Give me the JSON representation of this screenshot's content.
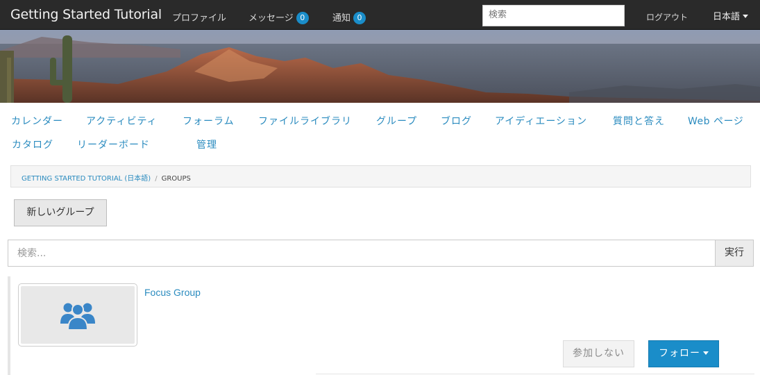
{
  "navbar": {
    "brand": "Getting Started Tutorial",
    "profile_label": "プロファイル",
    "messages_label": "メッセージ",
    "messages_count": "0",
    "notifications_label": "通知",
    "notifications_count": "0",
    "search_placeholder": "検索",
    "logout_label": "ログアウト",
    "language_label": "日本語"
  },
  "menu": {
    "items": [
      "カレンダー",
      "アクティビティ",
      "フォーラム",
      "ファイルライブラリ",
      "グループ",
      "ブログ",
      "アイディエーション",
      "質問と答え",
      "Web ページ",
      "カタログ",
      "リーダーボード",
      "管理"
    ]
  },
  "breadcrumb": {
    "root": "GETTING STARTED TUTORIAL (日本語)",
    "separator": "/",
    "current": "GROUPS"
  },
  "actions": {
    "new_group_label": "新しいグループ"
  },
  "group_search": {
    "placeholder": "検索...",
    "submit_label": "実行"
  },
  "groups": [
    {
      "name": "Focus Group",
      "icon": "users-icon",
      "unjoin_label": "参加しない",
      "follow_label": "フォロー"
    }
  ],
  "colors": {
    "accent": "#1a8dc9",
    "link": "#2a8bbf",
    "navbar": "#2a2a2a"
  }
}
